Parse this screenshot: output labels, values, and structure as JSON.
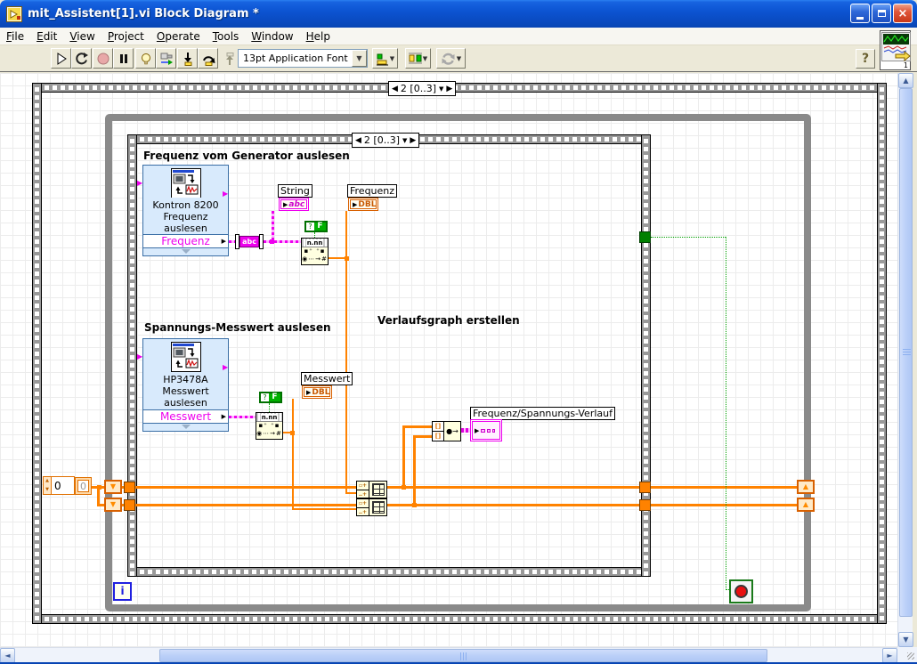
{
  "window": {
    "title": "mit_Assistent[1].vi Block Diagram *"
  },
  "menu": {
    "items": [
      "File",
      "Edit",
      "View",
      "Project",
      "Operate",
      "Tools",
      "Window",
      "Help"
    ]
  },
  "toolbar": {
    "font_selector": "13pt Application Font",
    "help_label": "?"
  },
  "diagram": {
    "outer_selector": "2 [0..3]",
    "inner_selector": "2 [0..3]",
    "section_labels": {
      "frequenz": "Frequenz vom Generator auslesen",
      "spannung": "Spannungs-Messwert auslesen",
      "graph": "Verlaufsgraph erstellen"
    },
    "express_vi_frequenz": {
      "line1": "Kontron 8200",
      "line2": "Frequenz",
      "line3": "auslesen",
      "output": "Frequenz"
    },
    "express_vi_messwert": {
      "line1": "HP3478A",
      "line2": "Messwert",
      "line3": "auslesen",
      "output": "Messwert"
    },
    "indicator_labels": {
      "string": "String",
      "frequenz": "Frequenz",
      "messwert": "Messwert",
      "graph": "Frequenz/Spannungs-Verlauf"
    },
    "terminals": {
      "string_type": "abc",
      "trim_label": "abc",
      "dbl_type": "DBL",
      "scan_header": "n.nn",
      "scan_row2": "▪⁺ ⁺▪",
      "scan_row3": "◉⋯→#",
      "bool_q": "?",
      "bool_f": "F",
      "iteration": "i",
      "bundle_glyph": "●→",
      "build_top": "▫+",
      "build_bottom": "‥+"
    },
    "constants": {
      "init_value": "0",
      "array_value": "0"
    }
  },
  "icons": {
    "selector_prev": "◀",
    "selector_next": "▶",
    "dropdown": "▼",
    "scroll_up": "▲",
    "scroll_down": "▼",
    "scroll_left": "◄",
    "scroll_right": "►",
    "shift_in": "▼",
    "shift_out": "▲",
    "term_arrow": "▶",
    "close": "×",
    "vi_number": "1"
  }
}
